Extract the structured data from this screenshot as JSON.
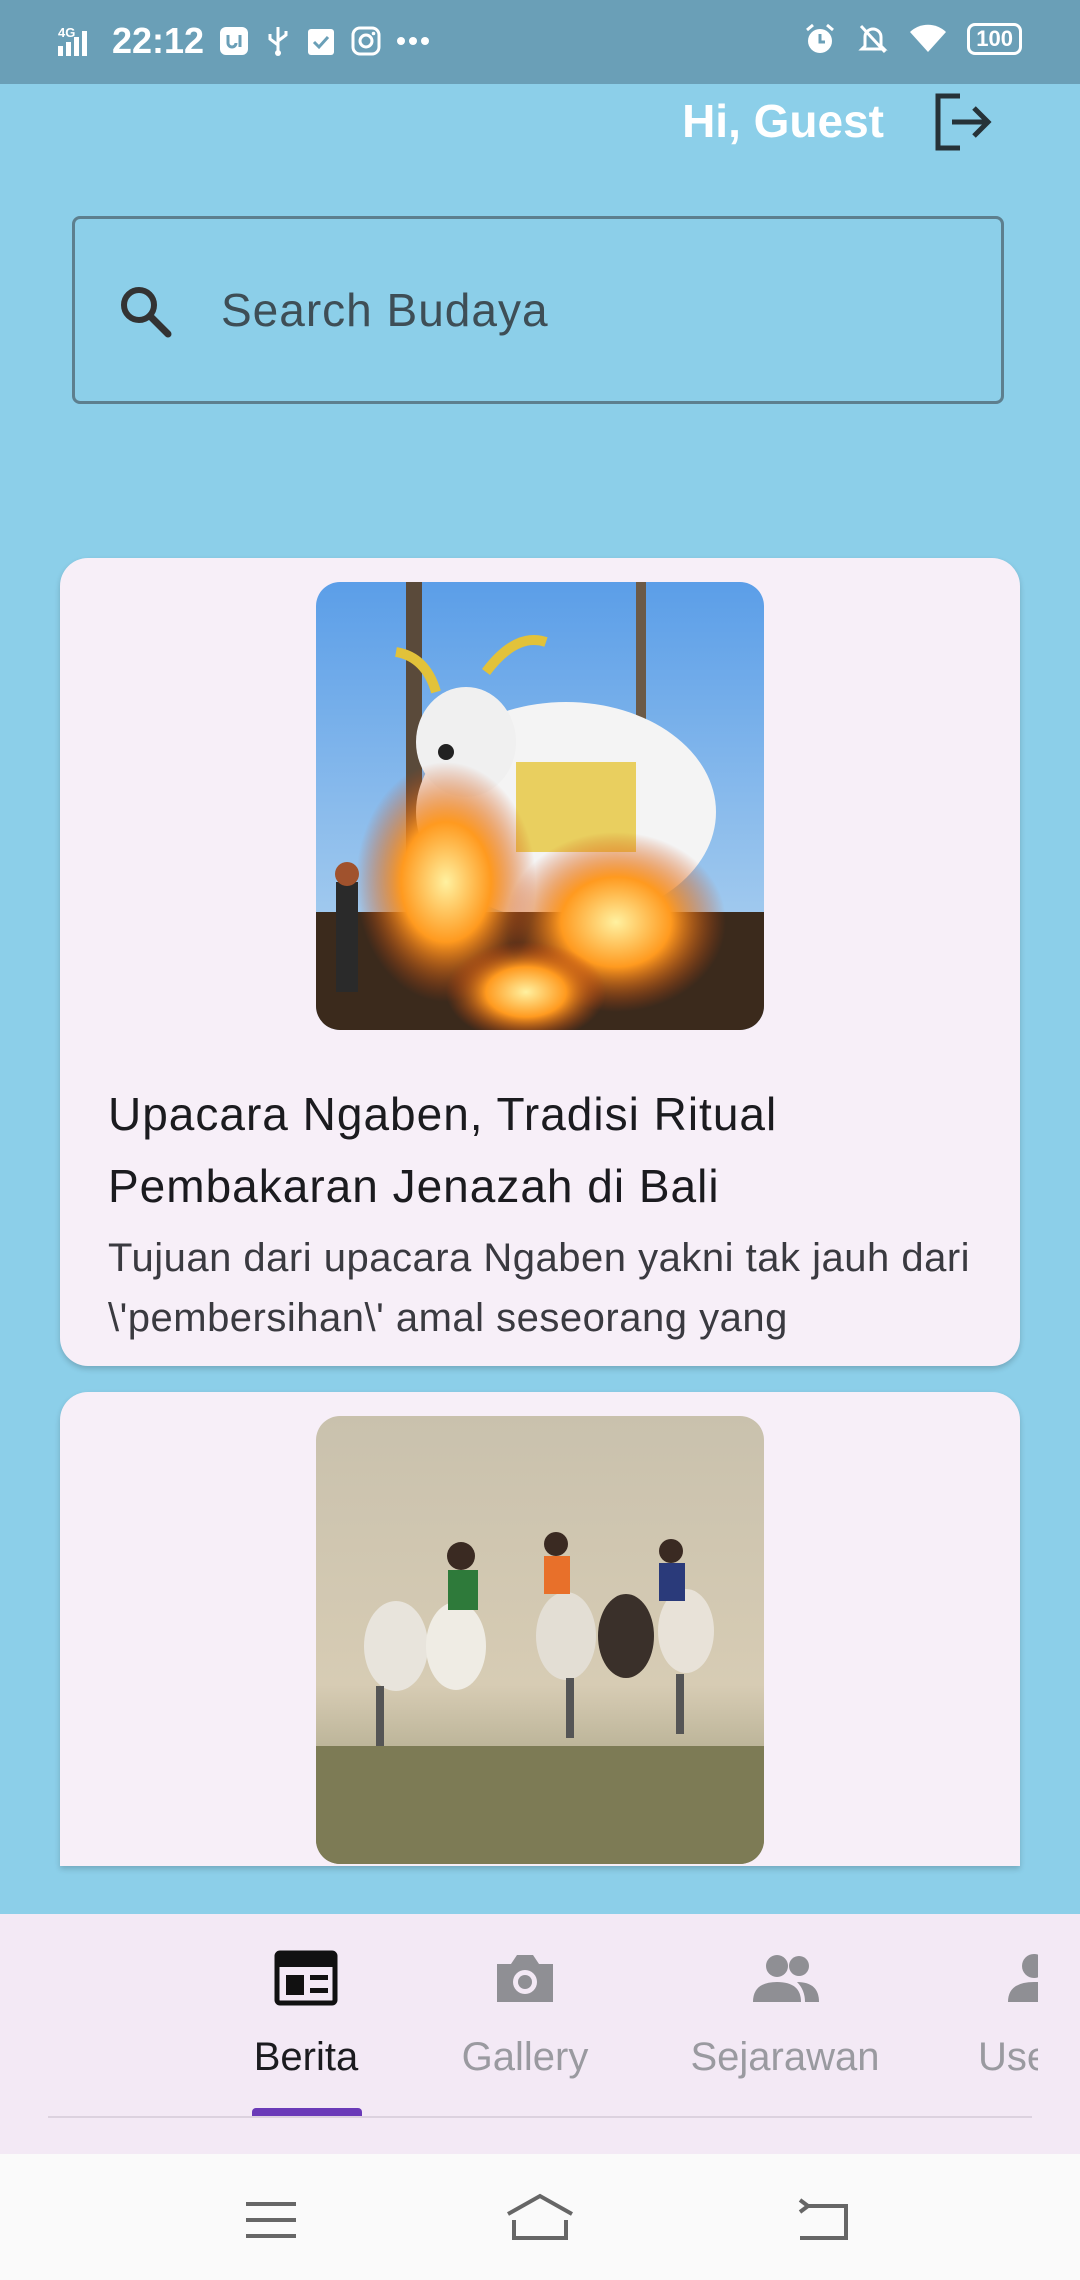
{
  "status_bar": {
    "network": "4G",
    "time": "22:12",
    "battery": "100",
    "left_icons": [
      "usb-debug-icon",
      "usb-icon",
      "task-icon",
      "instagram-icon",
      "more-dots-icon"
    ],
    "right_icons": [
      "alarm-icon",
      "mute-icon",
      "wifi-icon",
      "battery-icon"
    ]
  },
  "header": {
    "greeting": "Hi, Guest",
    "logout_icon": "logout-icon"
  },
  "search": {
    "placeholder": "Search Budaya",
    "icon": "search-icon"
  },
  "articles": [
    {
      "title": "Upacara Ngaben, Tradisi Ritual Pembakaran Jenazah di Bali",
      "description": "Tujuan dari upacara Ngaben yakni tak jauh dari \\'pembersihan\\' amal seseorang yang"
    },
    {
      "title": "",
      "description": ""
    }
  ],
  "bottom_nav": {
    "tabs": [
      {
        "label": "Berita",
        "icon": "newspaper-icon",
        "active": true
      },
      {
        "label": "Gallery",
        "icon": "camera-icon",
        "active": false
      },
      {
        "label": "Sejarawan",
        "icon": "people-icon",
        "active": false
      },
      {
        "label": "Use",
        "icon": "person-icon",
        "active": false
      }
    ]
  },
  "colors": {
    "background": "#8ccfe9",
    "status_bar": "#6a9fb7",
    "card": "#f7eff8",
    "nav": "#f3e9f5",
    "indicator": "#6a3ab8"
  }
}
